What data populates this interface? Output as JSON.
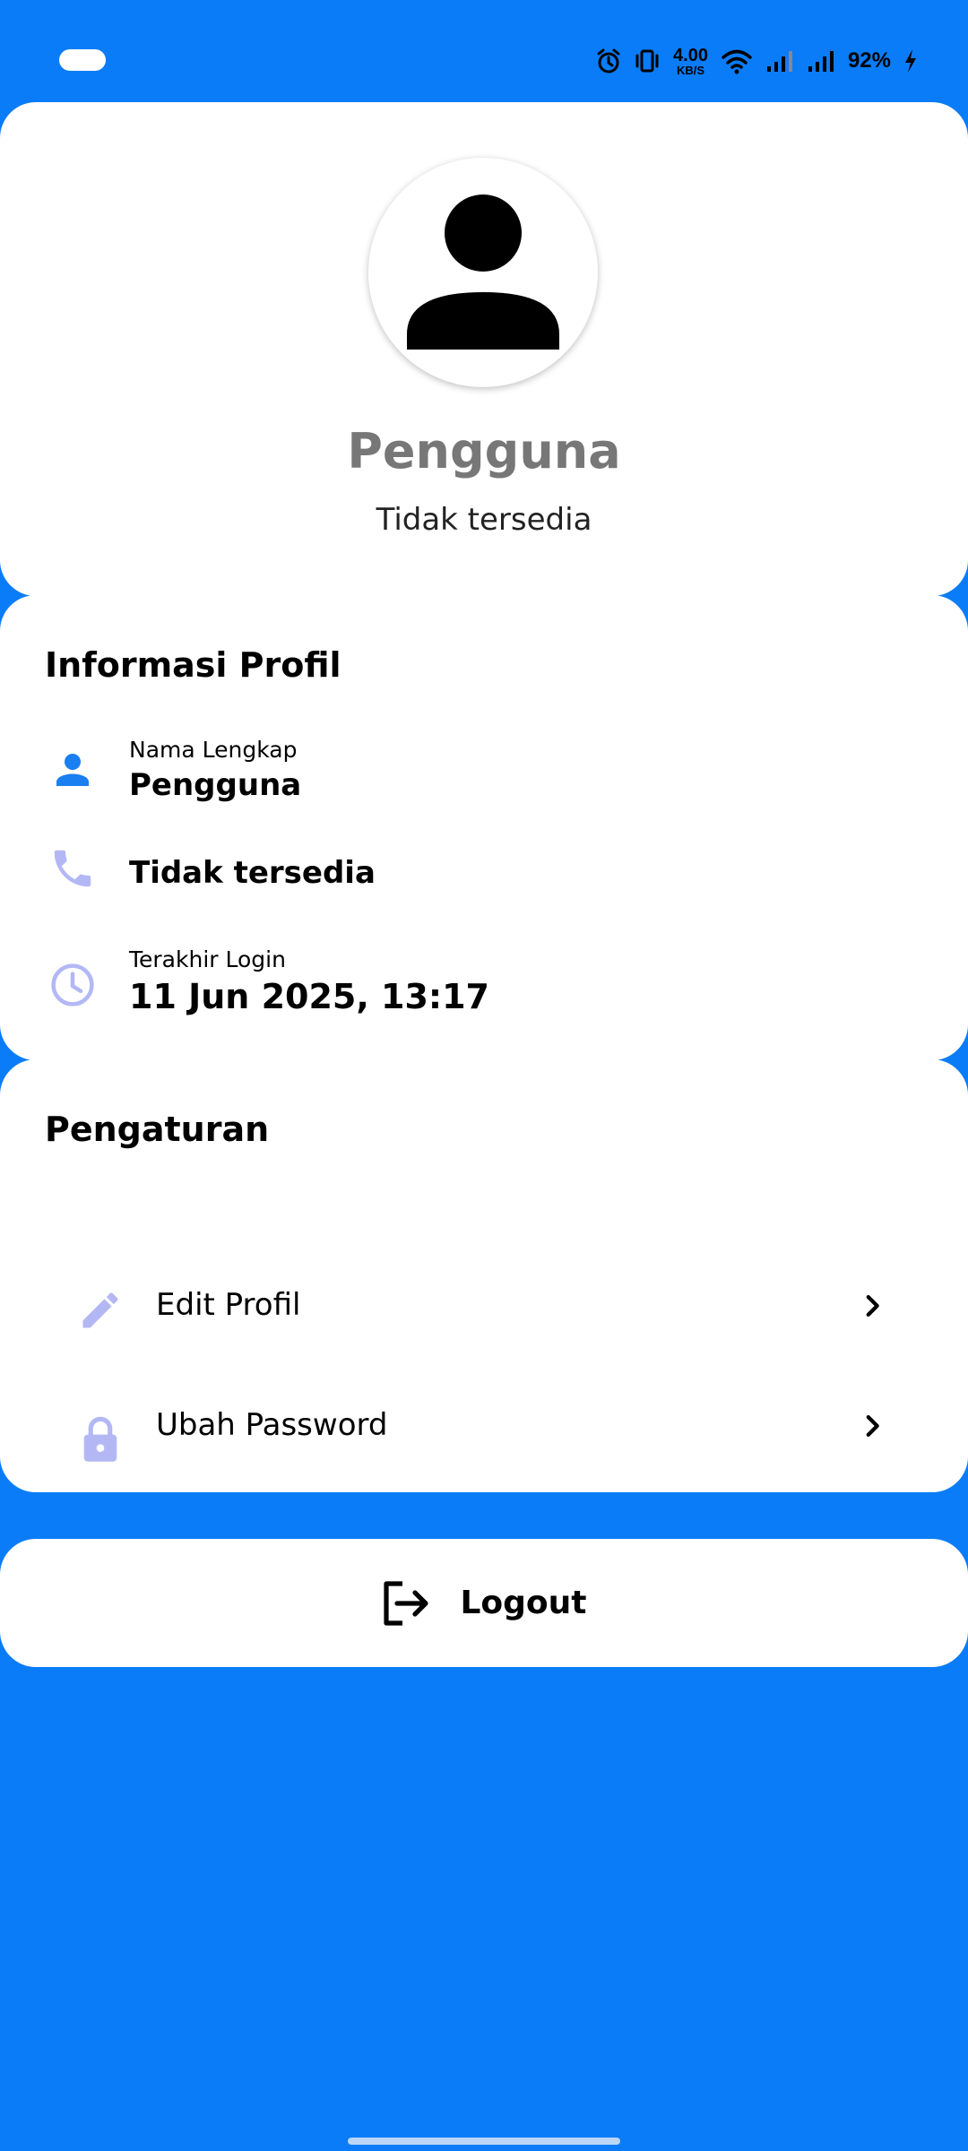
{
  "status_bar": {
    "network_speed_value": "4.00",
    "network_speed_unit": "KB/S",
    "battery_percent": "92%"
  },
  "profile": {
    "name": "Pengguna",
    "subtitle": "Tidak tersedia"
  },
  "info_section": {
    "title": "Informasi Profil",
    "full_name_label": "Nama Lengkap",
    "full_name_value": "Pengguna",
    "phone_value": "Tidak tersedia",
    "last_login_label": "Terakhir Login",
    "last_login_value": "11 Jun 2025, 13:17"
  },
  "settings_section": {
    "title": "Pengaturan",
    "items": [
      {
        "label": "Edit Profil",
        "icon": "pencil-icon"
      },
      {
        "label": "Ubah Password",
        "icon": "lock-icon"
      }
    ]
  },
  "logout": {
    "label": "Logout",
    "icon": "logout-icon"
  },
  "colors": {
    "background": "#0a7cf7",
    "accent_blue": "#1a7ff0",
    "icon_lavender": "#b3b8f5"
  }
}
